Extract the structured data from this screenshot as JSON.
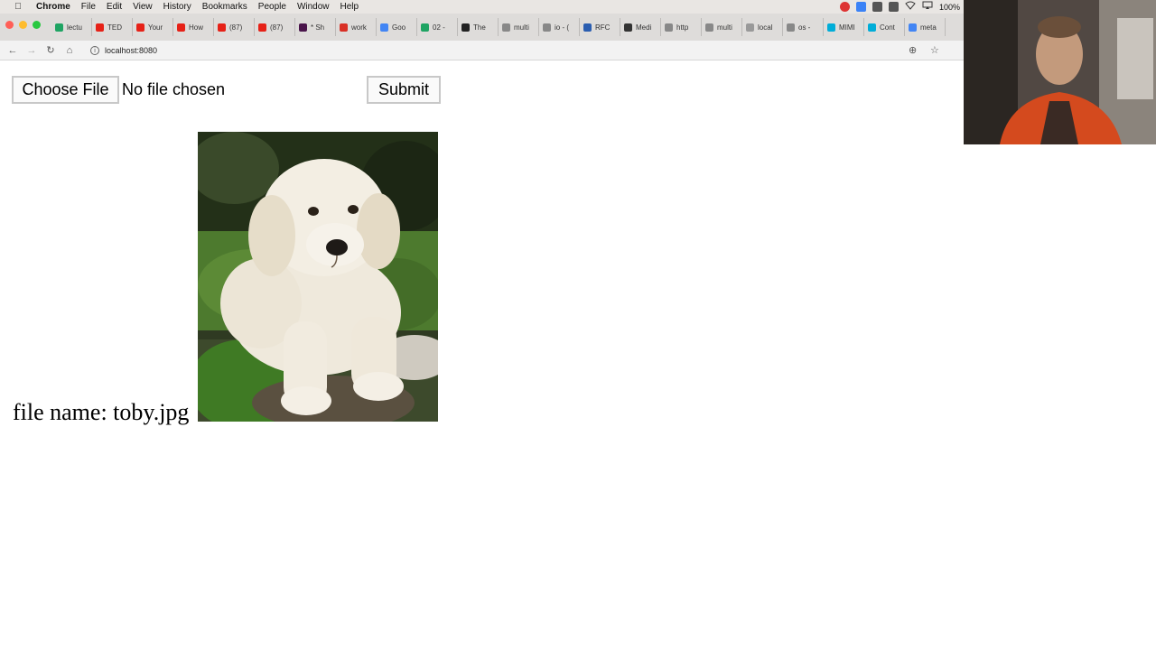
{
  "menubar": {
    "app": "Chrome",
    "items": [
      "File",
      "Edit",
      "View",
      "History",
      "Bookmarks",
      "People",
      "Window",
      "Help"
    ],
    "battery": "100%"
  },
  "tabs": [
    {
      "label": "lectu",
      "icon": "drive-icon",
      "color": "#1fa463"
    },
    {
      "label": "TED",
      "icon": "youtube-icon",
      "color": "#e62117"
    },
    {
      "label": "Your",
      "icon": "youtube-icon",
      "color": "#e62117"
    },
    {
      "label": "How",
      "icon": "youtube-icon",
      "color": "#e62117"
    },
    {
      "label": "(87)",
      "icon": "youtube-icon",
      "color": "#e62117"
    },
    {
      "label": "(87)",
      "icon": "youtube-icon",
      "color": "#e62117"
    },
    {
      "label": "* Sh",
      "icon": "hash-icon",
      "color": "#4a154b"
    },
    {
      "label": "work",
      "icon": "gmail-icon",
      "color": "#d93025"
    },
    {
      "label": "Goo",
      "icon": "google-account-icon",
      "color": "#4285f4"
    },
    {
      "label": "02 -",
      "icon": "drive-icon",
      "color": "#1fa463"
    },
    {
      "label": "The",
      "icon": "z-icon",
      "color": "#222222"
    },
    {
      "label": "multi",
      "icon": "search-icon",
      "color": "#888888"
    },
    {
      "label": "io - (",
      "icon": "search-icon",
      "color": "#888888"
    },
    {
      "label": "RFC",
      "icon": "rfc-icon",
      "color": "#2a5db0"
    },
    {
      "label": "Medi",
      "icon": "wikipedia-icon",
      "color": "#333333"
    },
    {
      "label": "http",
      "icon": "search-icon",
      "color": "#888888"
    },
    {
      "label": "multi",
      "icon": "search-icon",
      "color": "#888888"
    },
    {
      "label": "local",
      "icon": "page-icon",
      "color": "#999999"
    },
    {
      "label": "os -",
      "icon": "search-icon",
      "color": "#888888"
    },
    {
      "label": "MIMI",
      "icon": "gopher-icon",
      "color": "#00add8"
    },
    {
      "label": "Cont",
      "icon": "gopher-icon",
      "color": "#00add8"
    },
    {
      "label": "meta",
      "icon": "google-icon",
      "color": "#4285f4"
    }
  ],
  "toolbar": {
    "url": "localhost:8080"
  },
  "form": {
    "choose_file_label": "Choose File",
    "file_status": "No file chosen",
    "submit_label": "Submit"
  },
  "result": {
    "filename_text": "file name: toby.jpg"
  }
}
